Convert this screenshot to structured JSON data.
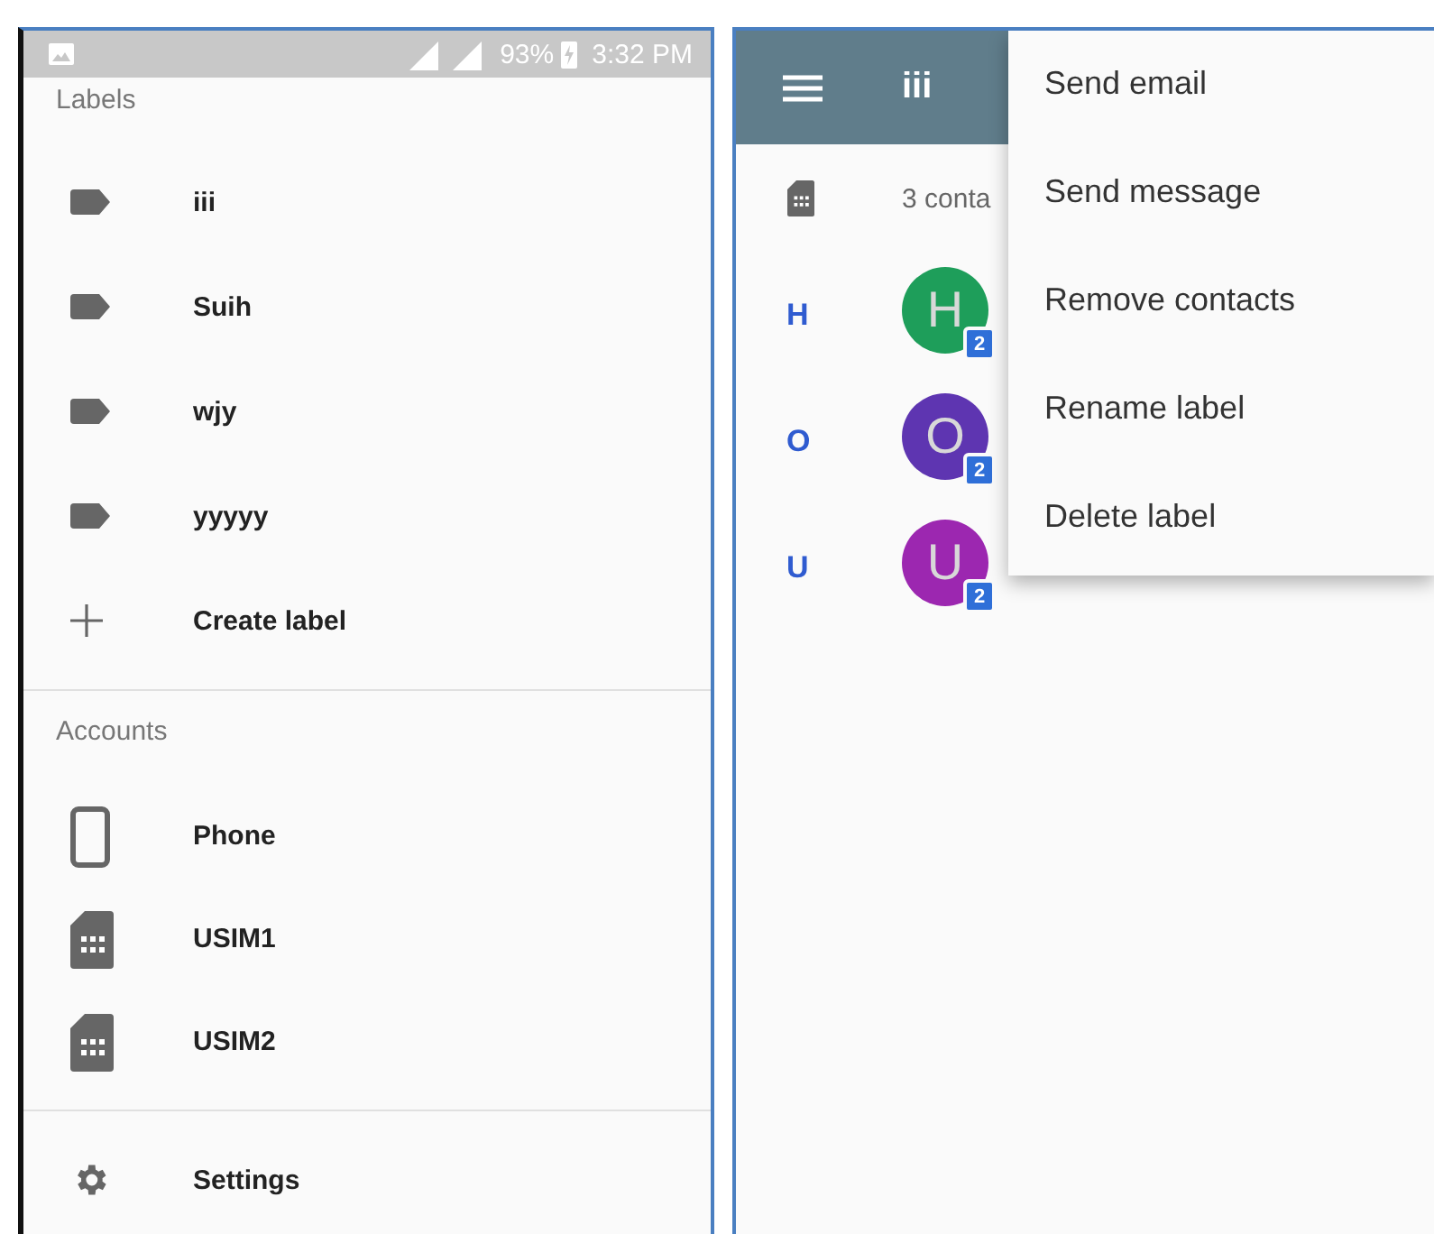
{
  "drawer": {
    "status_bar": {
      "battery": "93%",
      "time": "3:32 PM"
    },
    "labels_heading": "Labels",
    "labels": [
      {
        "name": "iii",
        "kind": "label"
      },
      {
        "name": "Suih",
        "kind": "label"
      },
      {
        "name": "wjy",
        "kind": "label"
      },
      {
        "name": "yyyyy",
        "kind": "label"
      },
      {
        "name": "Create label",
        "kind": "create"
      }
    ],
    "accounts_heading": "Accounts",
    "accounts": [
      {
        "name": "Phone",
        "kind": "phone"
      },
      {
        "name": "USIM1",
        "kind": "sim"
      },
      {
        "name": "USIM2",
        "kind": "sim"
      }
    ],
    "settings": "Settings"
  },
  "label_view": {
    "title": "iii",
    "account_summary": "3 conta",
    "contacts": [
      {
        "section": "H",
        "initial": "H",
        "color": "#1e9e5a",
        "badge": "2"
      },
      {
        "section": "O",
        "initial": "O",
        "color": "#5e35b1",
        "badge": "2"
      },
      {
        "section": "U",
        "initial": "U",
        "color": "#9c27b0",
        "badge": "2"
      }
    ],
    "menu": [
      "Send email",
      "Send message",
      "Remove contacts",
      "Rename label",
      "Delete label"
    ]
  }
}
